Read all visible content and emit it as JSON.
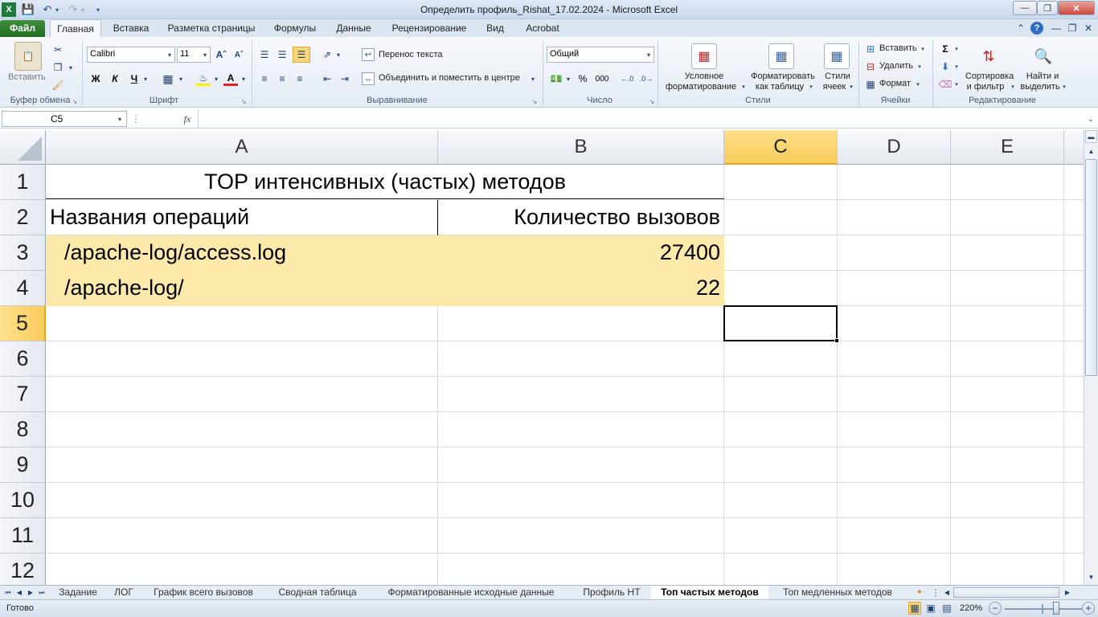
{
  "window": {
    "title": "Определить профиль_Rishat_17.02.2024  -  Microsoft Excel"
  },
  "tabs": {
    "file": "Файл",
    "items": [
      "Главная",
      "Вставка",
      "Разметка страницы",
      "Формулы",
      "Данные",
      "Рецензирование",
      "Вид",
      "Acrobat"
    ]
  },
  "ribbon": {
    "clipboard": {
      "paste": "Вставить",
      "group": "Буфер обмена"
    },
    "font": {
      "name": "Calibri",
      "size": "11",
      "bold": "Ж",
      "italic": "К",
      "underline": "Ч",
      "group": "Шрифт"
    },
    "alignment": {
      "wrap": "Перенос текста",
      "merge": "Объединить и поместить в центре",
      "group": "Выравнивание"
    },
    "number": {
      "format": "Общий",
      "percent": "%",
      "thousands": "000",
      "group": "Число"
    },
    "styles": {
      "conditional_1": "Условное",
      "conditional_2": "форматирование",
      "table_1": "Форматировать",
      "table_2": "как таблицу",
      "cell_1": "Стили",
      "cell_2": "ячеек",
      "group": "Стили"
    },
    "cells": {
      "insert": "Вставить",
      "delete": "Удалить",
      "format": "Формат",
      "group": "Ячейки"
    },
    "editing": {
      "sort_1": "Сортировка",
      "sort_2": "и фильтр",
      "find_1": "Найти и",
      "find_2": "выделить",
      "group": "Редактирование"
    }
  },
  "formula_bar": {
    "name_box": "C5",
    "fx": "fx",
    "value": ""
  },
  "grid": {
    "columns": [
      "A",
      "B",
      "C",
      "D",
      "E"
    ],
    "rows": [
      "1",
      "2",
      "3",
      "4",
      "5",
      "6",
      "7",
      "8",
      "9",
      "10",
      "11",
      "12"
    ],
    "title": "TOP интенсивных (частых) методов",
    "header_a": "Названия операций",
    "header_b": "Количество вызовов",
    "rows_data": [
      {
        "name": "/apache-log/access.log",
        "count": "27400"
      },
      {
        "name": "/apache-log/",
        "count": "22"
      }
    ],
    "highlight_color": "#fde9a9",
    "selection_color": "#f9cb5b"
  },
  "sheets": [
    "Задание",
    "ЛОГ",
    "График всего вызовов",
    "Сводная таблица",
    "Форматированные исходные данные",
    "Профиль НТ",
    "Топ частых методов",
    "Топ медленных методов"
  ],
  "status": {
    "ready": "Готово",
    "zoom": "220%"
  }
}
